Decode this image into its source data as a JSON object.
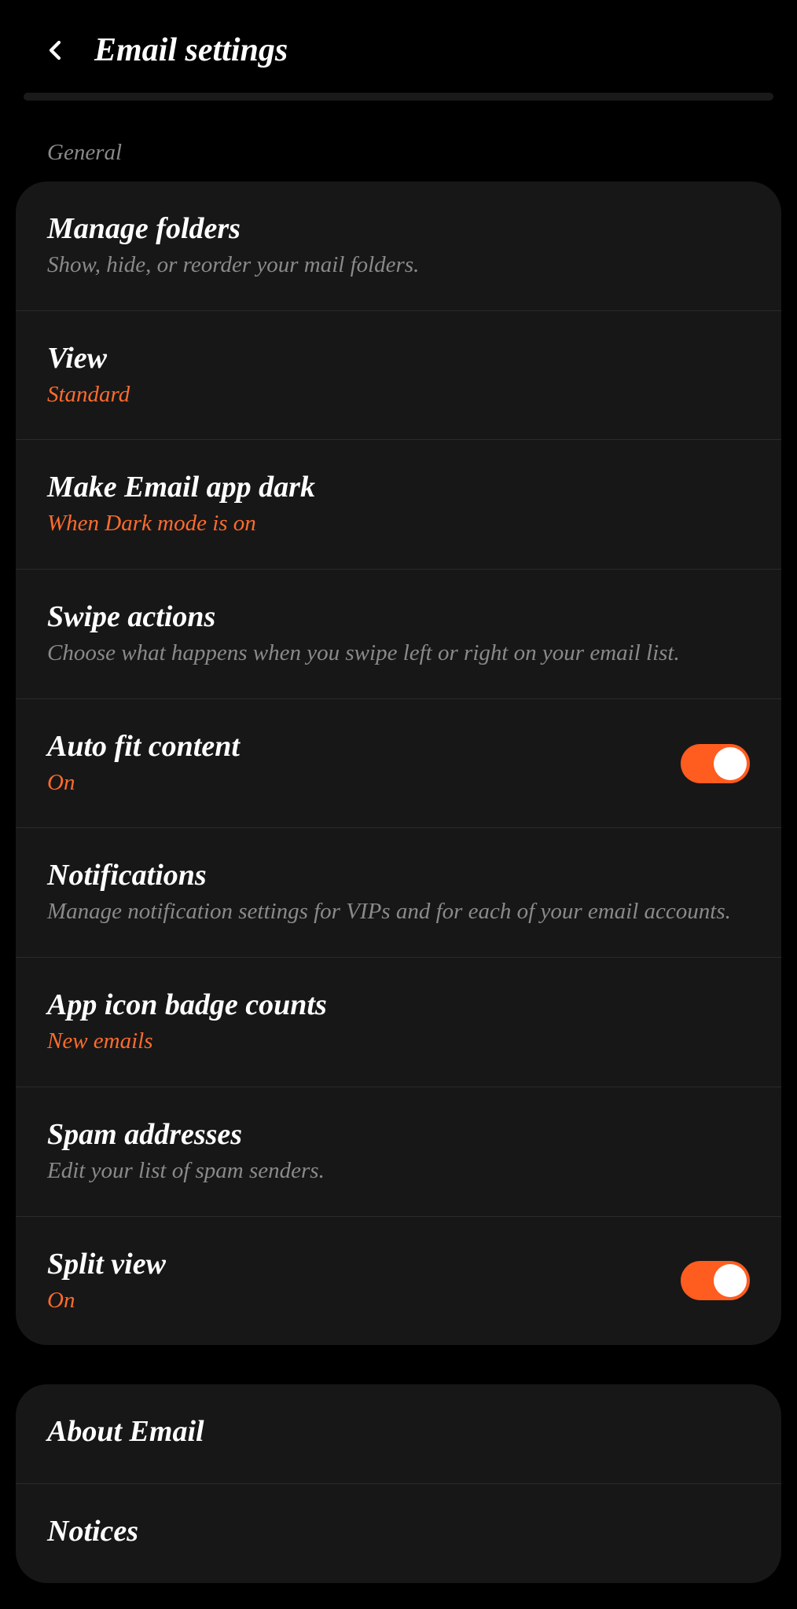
{
  "header": {
    "title": "Email settings"
  },
  "sections": {
    "general": {
      "label": "General",
      "items": {
        "manage_folders": {
          "title": "Manage folders",
          "subtitle": "Show, hide, or reorder your mail folders."
        },
        "view": {
          "title": "View",
          "subtitle": "Standard"
        },
        "dark_mode": {
          "title": "Make Email app dark",
          "subtitle": "When Dark mode is on"
        },
        "swipe_actions": {
          "title": "Swipe actions",
          "subtitle": "Choose what happens when you swipe left or right on your email list."
        },
        "auto_fit": {
          "title": "Auto fit content",
          "subtitle": "On",
          "toggle": true
        },
        "notifications": {
          "title": "Notifications",
          "subtitle": "Manage notification settings for VIPs and for each of your email accounts."
        },
        "badge_counts": {
          "title": "App icon badge counts",
          "subtitle": "New emails"
        },
        "spam_addresses": {
          "title": "Spam addresses",
          "subtitle": "Edit your list of spam senders."
        },
        "split_view": {
          "title": "Split view",
          "subtitle": "On",
          "toggle": true
        }
      }
    },
    "about": {
      "items": {
        "about_email": {
          "title": "About Email"
        },
        "notices": {
          "title": "Notices"
        }
      }
    }
  }
}
